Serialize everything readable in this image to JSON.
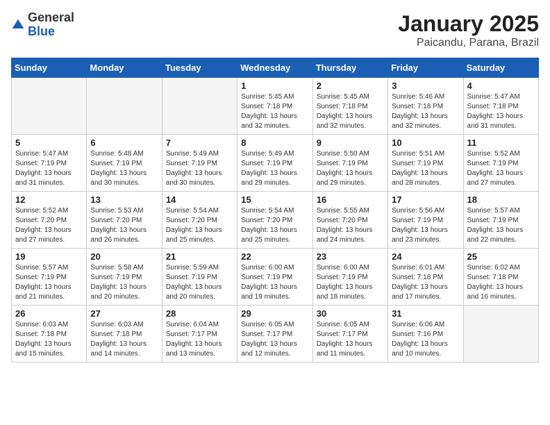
{
  "logo": {
    "general": "General",
    "blue": "Blue"
  },
  "title": "January 2025",
  "location": "Paicandu, Parana, Brazil",
  "days_header": [
    "Sunday",
    "Monday",
    "Tuesday",
    "Wednesday",
    "Thursday",
    "Friday",
    "Saturday"
  ],
  "weeks": [
    [
      {
        "day": "",
        "info": ""
      },
      {
        "day": "",
        "info": ""
      },
      {
        "day": "",
        "info": ""
      },
      {
        "day": "1",
        "info": "Sunrise: 5:45 AM\nSunset: 7:18 PM\nDaylight: 13 hours\nand 32 minutes."
      },
      {
        "day": "2",
        "info": "Sunrise: 5:45 AM\nSunset: 7:18 PM\nDaylight: 13 hours\nand 32 minutes."
      },
      {
        "day": "3",
        "info": "Sunrise: 5:46 AM\nSunset: 7:18 PM\nDaylight: 13 hours\nand 32 minutes."
      },
      {
        "day": "4",
        "info": "Sunrise: 5:47 AM\nSunset: 7:18 PM\nDaylight: 13 hours\nand 31 minutes."
      }
    ],
    [
      {
        "day": "5",
        "info": "Sunrise: 5:47 AM\nSunset: 7:19 PM\nDaylight: 13 hours\nand 31 minutes."
      },
      {
        "day": "6",
        "info": "Sunrise: 5:48 AM\nSunset: 7:19 PM\nDaylight: 13 hours\nand 30 minutes."
      },
      {
        "day": "7",
        "info": "Sunrise: 5:49 AM\nSunset: 7:19 PM\nDaylight: 13 hours\nand 30 minutes."
      },
      {
        "day": "8",
        "info": "Sunrise: 5:49 AM\nSunset: 7:19 PM\nDaylight: 13 hours\nand 29 minutes."
      },
      {
        "day": "9",
        "info": "Sunrise: 5:50 AM\nSunset: 7:19 PM\nDaylight: 13 hours\nand 29 minutes."
      },
      {
        "day": "10",
        "info": "Sunrise: 5:51 AM\nSunset: 7:19 PM\nDaylight: 13 hours\nand 28 minutes."
      },
      {
        "day": "11",
        "info": "Sunrise: 5:52 AM\nSunset: 7:19 PM\nDaylight: 13 hours\nand 27 minutes."
      }
    ],
    [
      {
        "day": "12",
        "info": "Sunrise: 5:52 AM\nSunset: 7:20 PM\nDaylight: 13 hours\nand 27 minutes."
      },
      {
        "day": "13",
        "info": "Sunrise: 5:53 AM\nSunset: 7:20 PM\nDaylight: 13 hours\nand 26 minutes."
      },
      {
        "day": "14",
        "info": "Sunrise: 5:54 AM\nSunset: 7:20 PM\nDaylight: 13 hours\nand 25 minutes."
      },
      {
        "day": "15",
        "info": "Sunrise: 5:54 AM\nSunset: 7:20 PM\nDaylight: 13 hours\nand 25 minutes."
      },
      {
        "day": "16",
        "info": "Sunrise: 5:55 AM\nSunset: 7:20 PM\nDaylight: 13 hours\nand 24 minutes."
      },
      {
        "day": "17",
        "info": "Sunrise: 5:56 AM\nSunset: 7:19 PM\nDaylight: 13 hours\nand 23 minutes."
      },
      {
        "day": "18",
        "info": "Sunrise: 5:57 AM\nSunset: 7:19 PM\nDaylight: 13 hours\nand 22 minutes."
      }
    ],
    [
      {
        "day": "19",
        "info": "Sunrise: 5:57 AM\nSunset: 7:19 PM\nDaylight: 13 hours\nand 21 minutes."
      },
      {
        "day": "20",
        "info": "Sunrise: 5:58 AM\nSunset: 7:19 PM\nDaylight: 13 hours\nand 20 minutes."
      },
      {
        "day": "21",
        "info": "Sunrise: 5:59 AM\nSunset: 7:19 PM\nDaylight: 13 hours\nand 20 minutes."
      },
      {
        "day": "22",
        "info": "Sunrise: 6:00 AM\nSunset: 7:19 PM\nDaylight: 13 hours\nand 19 minutes."
      },
      {
        "day": "23",
        "info": "Sunrise: 6:00 AM\nSunset: 7:19 PM\nDaylight: 13 hours\nand 18 minutes."
      },
      {
        "day": "24",
        "info": "Sunrise: 6:01 AM\nSunset: 7:18 PM\nDaylight: 13 hours\nand 17 minutes."
      },
      {
        "day": "25",
        "info": "Sunrise: 6:02 AM\nSunset: 7:18 PM\nDaylight: 13 hours\nand 16 minutes."
      }
    ],
    [
      {
        "day": "26",
        "info": "Sunrise: 6:03 AM\nSunset: 7:18 PM\nDaylight: 13 hours\nand 15 minutes."
      },
      {
        "day": "27",
        "info": "Sunrise: 6:03 AM\nSunset: 7:18 PM\nDaylight: 13 hours\nand 14 minutes."
      },
      {
        "day": "28",
        "info": "Sunrise: 6:04 AM\nSunset: 7:17 PM\nDaylight: 13 hours\nand 13 minutes."
      },
      {
        "day": "29",
        "info": "Sunrise: 6:05 AM\nSunset: 7:17 PM\nDaylight: 13 hours\nand 12 minutes."
      },
      {
        "day": "30",
        "info": "Sunrise: 6:05 AM\nSunset: 7:17 PM\nDaylight: 13 hours\nand 11 minutes."
      },
      {
        "day": "31",
        "info": "Sunrise: 6:06 AM\nSunset: 7:16 PM\nDaylight: 13 hours\nand 10 minutes."
      },
      {
        "day": "",
        "info": ""
      }
    ]
  ]
}
